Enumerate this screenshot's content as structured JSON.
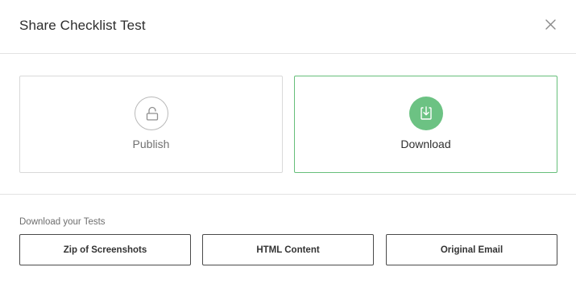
{
  "header": {
    "title": "Share Checklist Test",
    "close_icon": "close-icon"
  },
  "options": [
    {
      "label": "Publish",
      "icon": "lock-icon",
      "selected": false
    },
    {
      "label": "Download",
      "icon": "download-icon",
      "selected": true
    }
  ],
  "downloads": {
    "section_label": "Download your Tests",
    "buttons": [
      {
        "label": "Zip of Screenshots"
      },
      {
        "label": "HTML Content"
      },
      {
        "label": "Original Email"
      }
    ]
  },
  "colors": {
    "accent_green": "#6cc283",
    "selected_border": "#66bf7a",
    "divider": "#e3e3e3"
  }
}
